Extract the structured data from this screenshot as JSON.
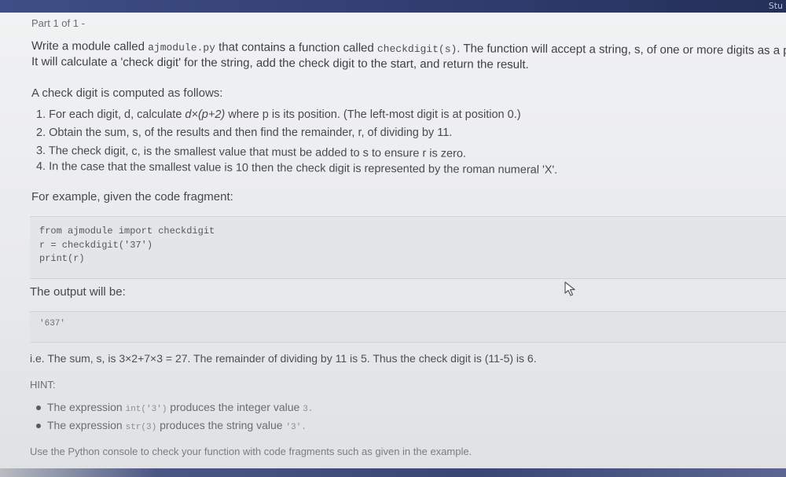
{
  "header": {
    "corner_text": "Stu"
  },
  "part_label": "Part 1 of 1 -",
  "intro": {
    "line1_pre": "Write a module called ",
    "module_name": "ajmodule.py",
    "line1_mid": " that contains a function called ",
    "function_sig": "checkdigit(s)",
    "line1_post": ". The function will accept a string, s, of one or more digits as a pa",
    "line2": "It will calculate a 'check digit' for the string, add the check digit to the start, and return the result."
  },
  "computed_heading": "A check digit is computed as follows:",
  "steps": [
    {
      "num": "1.",
      "text_a": "For each digit, d, calculate ",
      "formula": "d×(p+2)",
      "text_b": " where p is its position. (The left-most digit is at position 0.)"
    },
    {
      "num": "2.",
      "text": "Obtain the sum, s, of the results and then find the remainder, r, of dividing by 11."
    },
    {
      "num": "3.",
      "text": "The check digit, c, is the smallest value that must be added to s to ensure r is zero."
    },
    {
      "num": "4.",
      "text": "In the case that the smallest value is 10 then the check digit is represented by the roman numeral 'X'."
    }
  ],
  "example_label": "For example, given the code fragment:",
  "code_lines": [
    "from ajmodule import checkdigit",
    "r = checkdigit('37')",
    "print(r)"
  ],
  "output_label": "The output will be:",
  "output_value": "'637'",
  "explanation": "i.e. The sum, s, is 3×2+7×3 = 27. The remainder of dividing by 11 is 5. Thus the check digit is (11-5) is 6.",
  "hint_label": "HINT:",
  "hints": [
    {
      "pre": "The expression ",
      "code": "int('3')",
      "post": " produces the integer value ",
      "value": "3."
    },
    {
      "pre": "The expression ",
      "code": "str(3)",
      "post": " produces the string value ",
      "value": "'3'."
    }
  ],
  "console_note": "Use the Python console to check your function with code fragments such as given in the example."
}
